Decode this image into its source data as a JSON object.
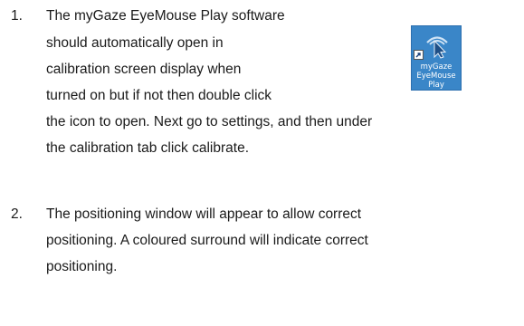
{
  "step1": {
    "number": "1.",
    "lines": [
      "The myGaze EyeMouse Play software",
      "should automatically open in",
      "calibration screen display when",
      "turned on but if not then double click",
      "the icon to open. Next go to settings, and then under",
      "the calibration tab click calibrate."
    ]
  },
  "step2": {
    "number": "2.",
    "lines": [
      "The positioning window will appear to allow correct",
      "positioning. A coloured surround will indicate correct",
      "positioning."
    ]
  },
  "desktop_icon": {
    "icon": "mygaze-eye-arrow-icon",
    "label_lines": [
      "myGaze",
      "EyeMouse",
      "Play"
    ],
    "background": "#3a86c8",
    "label_color": "#ffffff"
  }
}
